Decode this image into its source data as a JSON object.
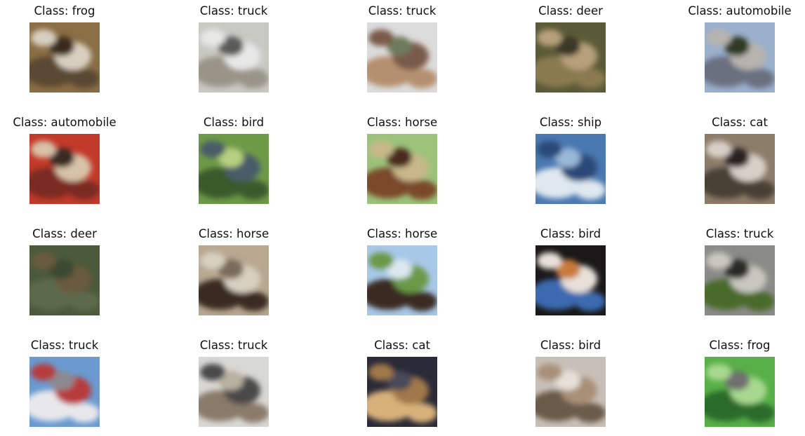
{
  "figure": {
    "rows": 4,
    "cols": 5,
    "panels": [
      {
        "title": "Class: frog",
        "subject": "frog-image",
        "palette": [
          "#8a6e45",
          "#5a4a30",
          "#d8cfc0",
          "#3a2c1c"
        ]
      },
      {
        "title": "Class: truck",
        "subject": "truck-image",
        "palette": [
          "#c9c9c4",
          "#9a9488",
          "#e8e8e8",
          "#5a5a58"
        ]
      },
      {
        "title": "Class: truck",
        "subject": "truck-image",
        "palette": [
          "#dcdcdc",
          "#b59070",
          "#7a5a48",
          "#6e7a5a"
        ]
      },
      {
        "title": "Class: deer",
        "subject": "deer-image",
        "palette": [
          "#5b5a38",
          "#8a7a50",
          "#b8a07a",
          "#3a3828"
        ]
      },
      {
        "title": "Class: automobile",
        "subject": "automobile-image",
        "palette": [
          "#9ab0cc",
          "#6a7080",
          "#b7b3ae",
          "#2e3a24"
        ]
      },
      {
        "title": "Class: automobile",
        "subject": "automobile-image",
        "palette": [
          "#c23a2a",
          "#7a2a20",
          "#d8c2a8",
          "#3a2a22"
        ]
      },
      {
        "title": "Class: bird",
        "subject": "bird-image",
        "palette": [
          "#6e9a48",
          "#3a5a2a",
          "#4a5c6a",
          "#b8d080"
        ]
      },
      {
        "title": "Class: horse",
        "subject": "horse-image",
        "palette": [
          "#9cc27a",
          "#7a4a2a",
          "#c8b88a",
          "#4a2a1a"
        ]
      },
      {
        "title": "Class: ship",
        "subject": "ship-image",
        "palette": [
          "#4a78b0",
          "#dfe8f0",
          "#2a4a78",
          "#9ab8d8"
        ]
      },
      {
        "title": "Class: cat",
        "subject": "cat-image",
        "palette": [
          "#8c7c6a",
          "#4a4034",
          "#d8d0c8",
          "#2a2420"
        ]
      },
      {
        "title": "Class: deer",
        "subject": "deer-image",
        "palette": [
          "#4a5a3a",
          "#5c6a48",
          "#6a5a40",
          "#3a4830"
        ]
      },
      {
        "title": "Class: horse",
        "subject": "horse-image",
        "palette": [
          "#b8a890",
          "#3a2a22",
          "#d8d0c0",
          "#7a6a5a"
        ]
      },
      {
        "title": "Class: horse",
        "subject": "horse-image",
        "palette": [
          "#a8c8e8",
          "#3a2a20",
          "#6a9a4a",
          "#dce8f0"
        ]
      },
      {
        "title": "Class: bird",
        "subject": "bird-image",
        "palette": [
          "#1a1818",
          "#3a6ab0",
          "#e8e0d8",
          "#c87a3a"
        ]
      },
      {
        "title": "Class: truck",
        "subject": "truck-image",
        "palette": [
          "#8a8a88",
          "#4a6a2a",
          "#c8c8c0",
          "#2a2a28"
        ]
      },
      {
        "title": "Class: truck",
        "subject": "truck-image",
        "palette": [
          "#6a9ad0",
          "#e8e8ec",
          "#b83a3a",
          "#8a8a90"
        ]
      },
      {
        "title": "Class: truck",
        "subject": "truck-image",
        "palette": [
          "#d8d8d4",
          "#8a7a6a",
          "#4a4a48",
          "#b8b0a0"
        ]
      },
      {
        "title": "Class: cat",
        "subject": "cat-image",
        "palette": [
          "#2a2a38",
          "#d8b07a",
          "#a07848",
          "#4a4a5a"
        ]
      },
      {
        "title": "Class: bird",
        "subject": "bird-image",
        "palette": [
          "#c8c0b8",
          "#6a5a48",
          "#a89078",
          "#e8e0d8"
        ]
      },
      {
        "title": "Class: frog",
        "subject": "frog-image",
        "palette": [
          "#58b048",
          "#2a6a2a",
          "#a8d890",
          "#707070"
        ]
      }
    ]
  }
}
